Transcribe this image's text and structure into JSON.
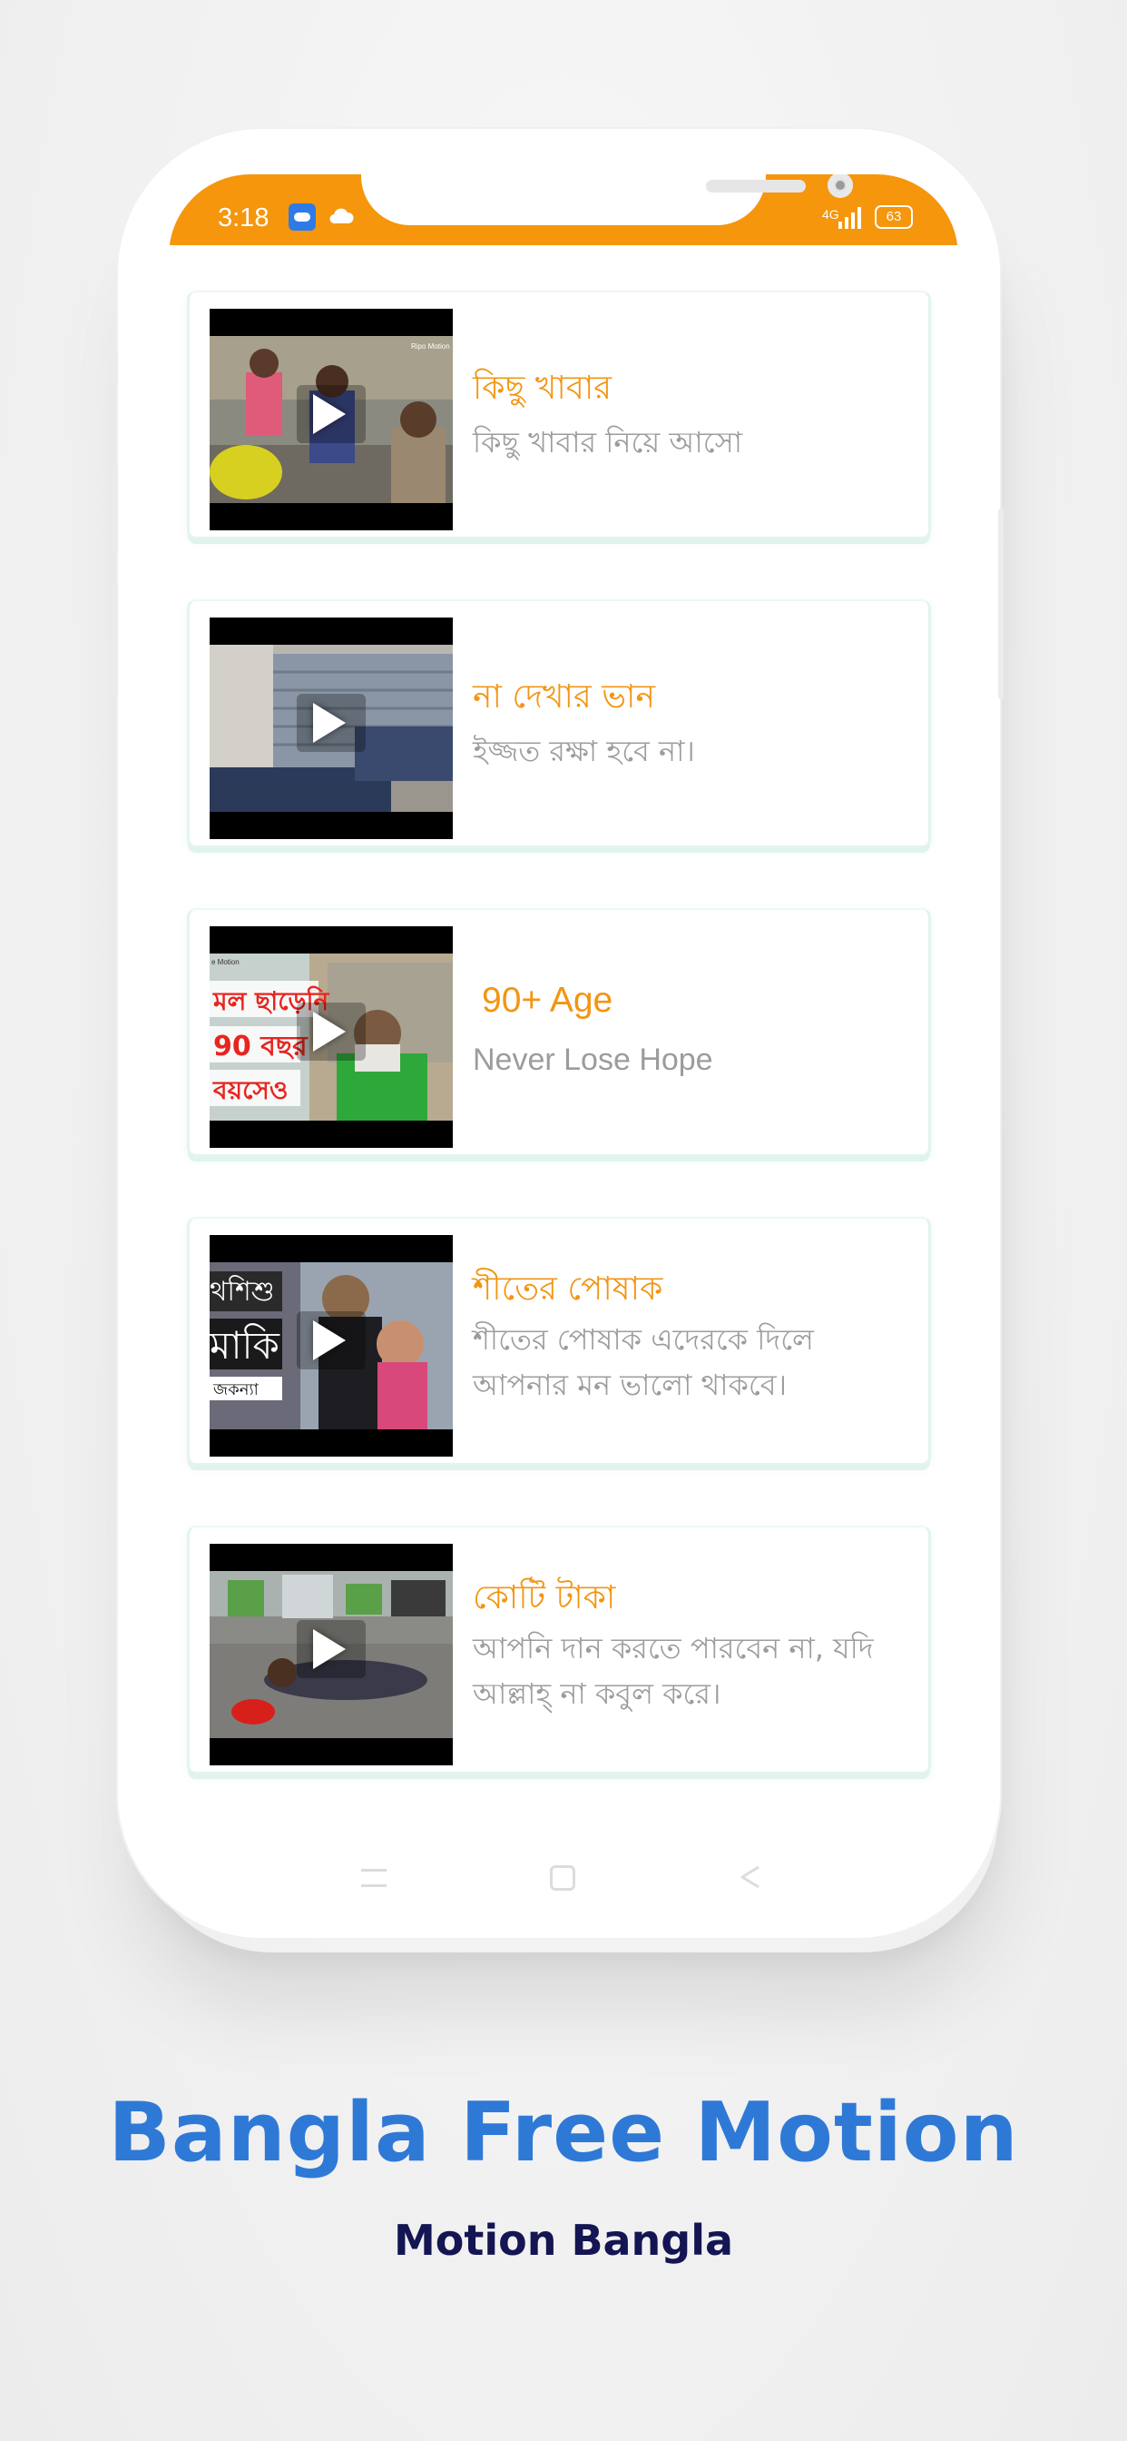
{
  "status_bar": {
    "time": "3:18",
    "network": "4G",
    "battery": "63"
  },
  "videos": [
    {
      "title": "কিছু খাবার",
      "subtitle": "কিছু খাবার নিয়ে আসো"
    },
    {
      "title": "না দেখার ভান",
      "subtitle": "ইজ্জত রক্ষা হবে না।"
    },
    {
      "title": "90+ Age",
      "subtitle": "Never Lose Hope"
    },
    {
      "title": "শীতের পোষাক",
      "subtitle": "শীতের পোষাক এদেরকে দিলে আপনার মন ভালো থাকবে।"
    },
    {
      "title": "কোটি টাকা",
      "subtitle": "আপনি দান করতে পারবেন না, যদি আল্লাহ্ না কবুল করে।"
    }
  ],
  "thumbnail_text": {
    "video_1": "Ripo Motion",
    "video_3": [
      "মল ছাড়েনি",
      "90 বছর",
      "বয়সেও",
      "e Motion"
    ],
    "video_4": [
      "থশিশু",
      "মাকি",
      "জকন্যা"
    ]
  },
  "promo": {
    "title": "Bangla Free Motion",
    "subtitle": "Motion Bangla"
  },
  "colors": {
    "accent": "#f5960d",
    "title_text": "#f39512",
    "subtitle_text": "#9c9c9c",
    "brand_blue": "#2f79d6",
    "brand_navy": "#141553"
  }
}
